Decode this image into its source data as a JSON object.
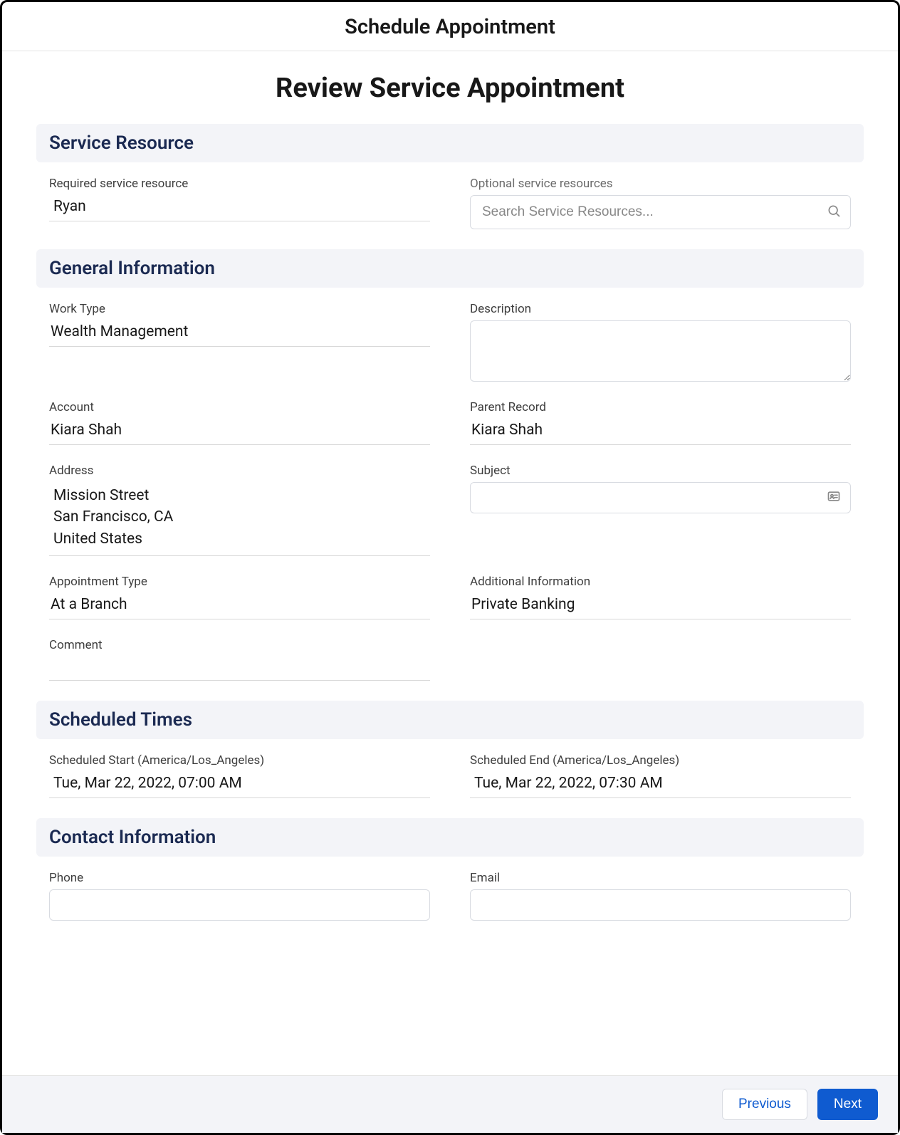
{
  "header": {
    "title": "Schedule Appointment"
  },
  "page": {
    "title": "Review Service Appointment"
  },
  "sections": {
    "service_resource": {
      "heading": "Service Resource",
      "required_label": "Required service resource",
      "required_value": "Ryan",
      "optional_label": "Optional service resources",
      "optional_placeholder": "Search Service Resources..."
    },
    "general_info": {
      "heading": "General Information",
      "work_type_label": "Work Type",
      "work_type_value": "Wealth Management",
      "description_label": "Description",
      "description_value": "",
      "account_label": "Account",
      "account_value": "Kiara Shah",
      "parent_record_label": "Parent Record",
      "parent_record_value": "Kiara Shah",
      "address_label": "Address",
      "address_value": "Mission Street\nSan Francisco, CA\nUnited States",
      "subject_label": "Subject",
      "subject_value": "",
      "appt_type_label": "Appointment Type",
      "appt_type_value": "At a Branch",
      "additional_label": "Additional Information",
      "additional_value": "Private Banking",
      "comment_label": "Comment",
      "comment_value": ""
    },
    "scheduled_times": {
      "heading": "Scheduled Times",
      "start_label": "Scheduled Start (America/Los_Angeles)",
      "start_value": "Tue, Mar 22, 2022, 07:00 AM",
      "end_label": "Scheduled End (America/Los_Angeles)",
      "end_value": "Tue, Mar 22, 2022, 07:30 AM"
    },
    "contact_info": {
      "heading": "Contact Information",
      "phone_label": "Phone",
      "phone_value": "",
      "email_label": "Email",
      "email_value": ""
    }
  },
  "footer": {
    "previous_label": "Previous",
    "next_label": "Next"
  }
}
